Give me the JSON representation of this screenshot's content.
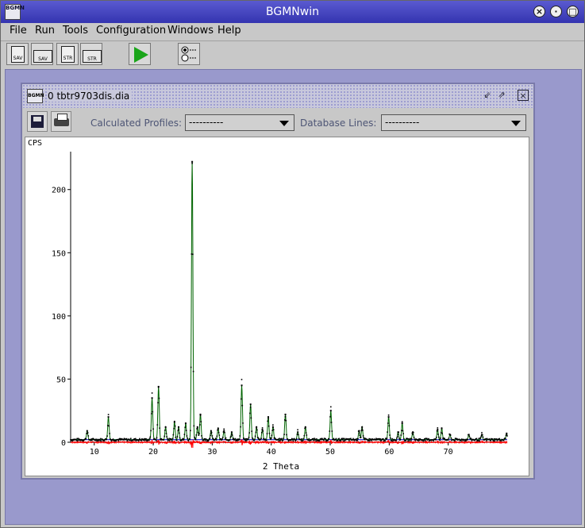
{
  "window": {
    "title": "BGMNwin",
    "app_icon_text": "BGMN"
  },
  "menu": {
    "items": [
      {
        "label": "File",
        "mnemonic": "F"
      },
      {
        "label": "Run",
        "mnemonic": "R"
      },
      {
        "label": "Tools",
        "mnemonic": "T"
      },
      {
        "label": "Configuration",
        "mnemonic": "C"
      },
      {
        "label": "Windows",
        "mnemonic": "W"
      },
      {
        "label": "Help",
        "mnemonic": "H"
      }
    ]
  },
  "toolbar": {
    "save_doc_label": "SAV",
    "open_sav_label": "SAV",
    "new_str_label": "STR",
    "open_str_label": "STR"
  },
  "frame": {
    "title": "0 tbtr9703dis.dia",
    "calc_profiles_label": "Calculated Profiles:",
    "calc_profiles_value": "----------",
    "db_lines_label": "Database Lines:",
    "db_lines_value": "----------"
  },
  "chart_data": {
    "type": "line",
    "ylabel": "CPS",
    "xlabel": "2 Theta",
    "xlim": [
      6,
      80
    ],
    "ylim": [
      0,
      230
    ],
    "x_ticks": [
      10,
      20,
      30,
      40,
      50,
      60,
      70
    ],
    "y_ticks": [
      0,
      50,
      100,
      150,
      200
    ],
    "colors": {
      "observed": "#000000",
      "calculated": "#006400",
      "background": "#0000cc",
      "difference": "#ff0000"
    },
    "peaks": [
      {
        "x": 8.8,
        "y": 9
      },
      {
        "x": 12.4,
        "y": 20
      },
      {
        "x": 19.8,
        "y": 35
      },
      {
        "x": 20.9,
        "y": 44
      },
      {
        "x": 22.1,
        "y": 12
      },
      {
        "x": 23.6,
        "y": 16
      },
      {
        "x": 24.3,
        "y": 12
      },
      {
        "x": 25.5,
        "y": 15
      },
      {
        "x": 26.6,
        "y": 222
      },
      {
        "x": 27.5,
        "y": 12
      },
      {
        "x": 28.0,
        "y": 22
      },
      {
        "x": 29.8,
        "y": 9
      },
      {
        "x": 31.0,
        "y": 11
      },
      {
        "x": 32.0,
        "y": 9
      },
      {
        "x": 33.3,
        "y": 8
      },
      {
        "x": 35.0,
        "y": 45
      },
      {
        "x": 36.5,
        "y": 30
      },
      {
        "x": 37.5,
        "y": 12
      },
      {
        "x": 38.5,
        "y": 10
      },
      {
        "x": 39.5,
        "y": 20
      },
      {
        "x": 40.3,
        "y": 12
      },
      {
        "x": 42.4,
        "y": 22
      },
      {
        "x": 44.5,
        "y": 8
      },
      {
        "x": 45.8,
        "y": 12
      },
      {
        "x": 50.1,
        "y": 25
      },
      {
        "x": 54.9,
        "y": 9
      },
      {
        "x": 55.4,
        "y": 12
      },
      {
        "x": 59.9,
        "y": 20
      },
      {
        "x": 61.5,
        "y": 8
      },
      {
        "x": 62.2,
        "y": 15
      },
      {
        "x": 64.0,
        "y": 8
      },
      {
        "x": 68.2,
        "y": 10
      },
      {
        "x": 68.9,
        "y": 11
      },
      {
        "x": 70.3,
        "y": 6
      },
      {
        "x": 73.5,
        "y": 6
      },
      {
        "x": 75.7,
        "y": 6
      },
      {
        "x": 79.9,
        "y": 7
      }
    ]
  }
}
